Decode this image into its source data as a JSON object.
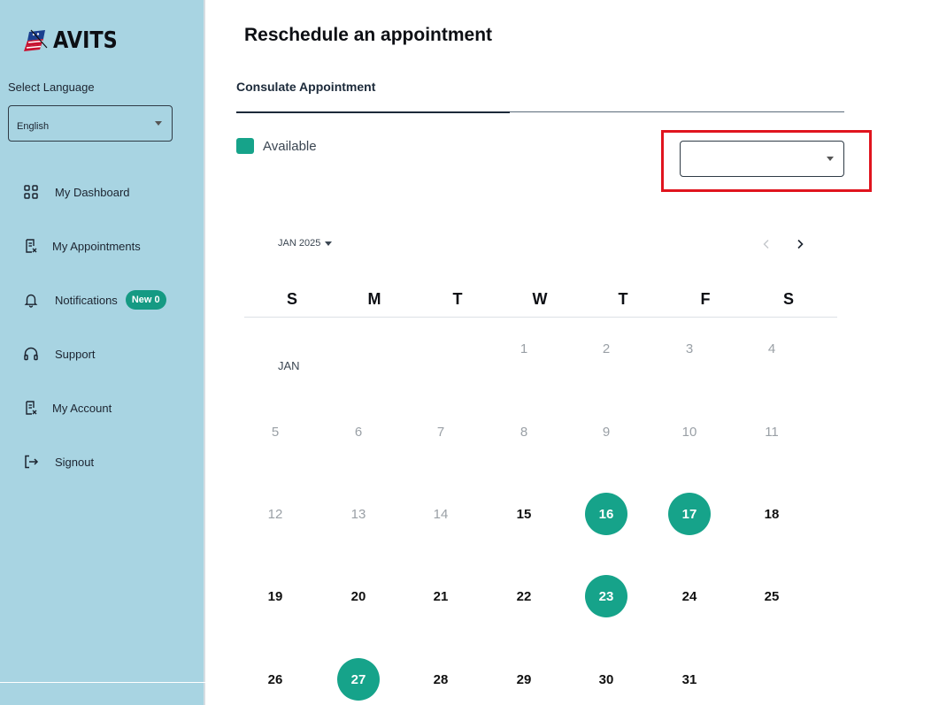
{
  "brand": {
    "name": "AVITS"
  },
  "sidebar": {
    "language_label": "Select Language",
    "language_value": "English",
    "items": [
      {
        "label": "My Dashboard",
        "icon": "dashboard-grid-icon"
      },
      {
        "label": "My Appointments",
        "icon": "document-icon"
      },
      {
        "label": "Notifications",
        "icon": "bell-icon",
        "badge": "New 0"
      },
      {
        "label": "Support",
        "icon": "headset-icon"
      },
      {
        "label": "My Account",
        "icon": "document-icon"
      },
      {
        "label": "Signout",
        "icon": "signout-icon"
      }
    ]
  },
  "main": {
    "title": "Reschedule an appointment",
    "tab": "Consulate Appointment",
    "legend_label": "Available",
    "location_select_value": ""
  },
  "calendar": {
    "month_picker": "JAN 2025",
    "month_label": "JAN",
    "weekdays": [
      "S",
      "M",
      "T",
      "W",
      "T",
      "F",
      "S"
    ],
    "first_weekday": 3,
    "days_in_month": 31,
    "available_days": [
      16,
      17,
      23,
      27
    ],
    "enabled_days": [
      15,
      18,
      19,
      20,
      21,
      22,
      24,
      25,
      26,
      28,
      29,
      30,
      31
    ],
    "disabled_days": [
      1,
      2,
      3,
      4,
      5,
      6,
      7,
      8,
      9,
      10,
      11,
      12,
      13,
      14
    ]
  },
  "colors": {
    "sidebar_bg": "#a8d4e2",
    "accent": "#16a38a",
    "highlight": "#e0141e"
  }
}
